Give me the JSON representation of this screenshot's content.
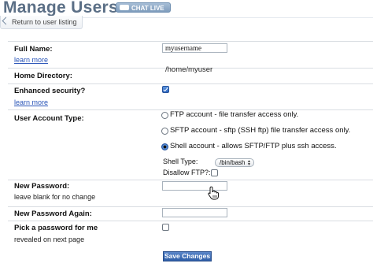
{
  "header": {
    "title": "Manage Users",
    "chat_badge": "CHAT LIVE",
    "back_link": "Return to user listing"
  },
  "form": {
    "full_name": {
      "label": "Full Name:",
      "help_link": "learn more",
      "value": "myusername"
    },
    "home_directory": {
      "label": "Home Directory:",
      "value": "/home/myuser"
    },
    "enhanced_security": {
      "label": "Enhanced security?",
      "help_link": "learn more",
      "checked": true
    },
    "account_type": {
      "label": "User Account Type:",
      "options": [
        {
          "label": "FTP account - file transfer access only.",
          "selected": false
        },
        {
          "label": "SFTP account - sftp (SSH ftp) file transfer access only.",
          "selected": false
        },
        {
          "label": "Shell account - allows SFTP/FTP plus ssh access.",
          "selected": true
        }
      ],
      "shell_type_label": "Shell Type:",
      "shell_type_value": "/bin/bash",
      "disallow_ftp_label": "Disallow FTP?:",
      "disallow_ftp_checked": false
    },
    "new_password": {
      "label": "New Password:",
      "hint": "leave blank for no change",
      "value": ""
    },
    "new_password_again": {
      "label": "New Password Again:",
      "value": ""
    },
    "pick_password": {
      "label": "Pick a password for me",
      "hint": "revealed on next page",
      "checked": false
    },
    "save_button": "Save Changes"
  },
  "colors": {
    "title": "#5b6f86",
    "link": "#2a55b8",
    "button": "#2e5ea7"
  }
}
